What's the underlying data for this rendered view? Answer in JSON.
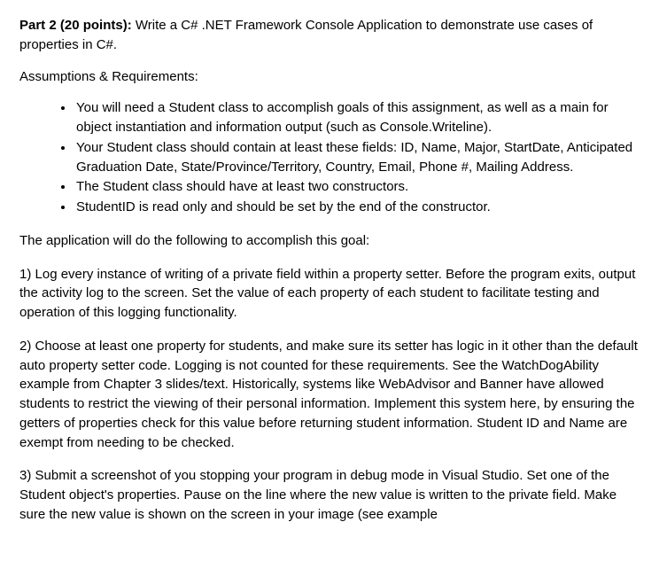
{
  "heading": {
    "title": "Part 2 (20 points):",
    "rest": " Write a C# .NET Framework Console Application to demonstrate use cases of properties in C#."
  },
  "assumptions_label": "Assumptions & Requirements:",
  "bullets": [
    "You will need a Student class to accomplish goals of this assignment, as well as a main for object instantiation and information output (such as Console.Writeline).",
    "Your Student class should contain at least these fields: ID, Name, Major, StartDate, Anticipated Graduation Date, State/Province/Territory, Country, Email, Phone #, Mailing Address.",
    "The Student class should have at least two constructors.",
    "StudentID is read only and should be set by the end of the constructor."
  ],
  "intro_line": "The application will do the following to accomplish this goal:",
  "paragraphs": [
    "1) Log every instance of writing of a private field within a property setter. Before the program exits, output the activity log to the screen. Set the value of each property of each student to facilitate testing and operation of this logging functionality.",
    "2) Choose at least one property for students, and make sure its setter has logic in it other than the default auto property setter code. Logging is not counted for these requirements. See the WatchDogAbility example from Chapter 3 slides/text. Historically, systems like WebAdvisor and Banner have allowed students to restrict the viewing of their personal information. Implement this system here, by ensuring the getters of properties check for this value before returning student information. Student ID and Name are exempt from needing to be checked.",
    "3) Submit a screenshot of you stopping your program in debug mode in Visual Studio. Set one of the Student object's properties. Pause on the line where the new value is written to the private field. Make sure the new value is shown on the screen in your image (see example"
  ]
}
